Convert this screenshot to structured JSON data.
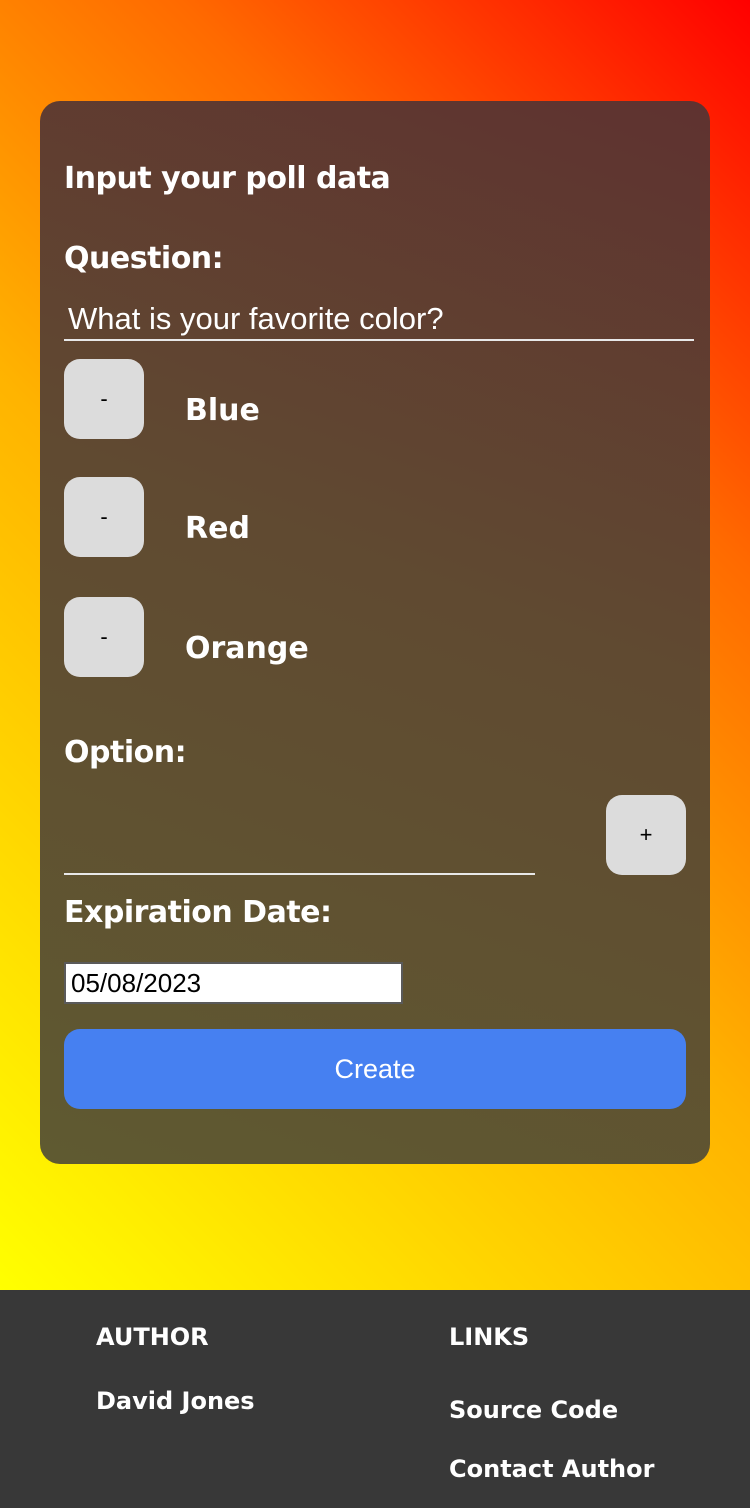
{
  "form": {
    "title": "Input your poll data",
    "question_label": "Question:",
    "question_value": "What is your favorite color?",
    "options": [
      {
        "remove_label": "-",
        "label": "Blue"
      },
      {
        "remove_label": "-",
        "label": "Red"
      },
      {
        "remove_label": "-",
        "label": "Orange"
      }
    ],
    "option_label": "Option:",
    "option_value": "",
    "add_label": "+",
    "expiration_label": "Expiration Date:",
    "expiration_value": "05/08/2023",
    "create_label": "Create"
  },
  "footer": {
    "author_heading": "AUTHOR",
    "author_name": "David Jones",
    "links_heading": "LINKS",
    "links": [
      "Source Code",
      "Contact Author"
    ]
  },
  "colors": {
    "create_button": "#4680f1",
    "footer_background": "#383838",
    "option_button": "#dcdcdc"
  }
}
